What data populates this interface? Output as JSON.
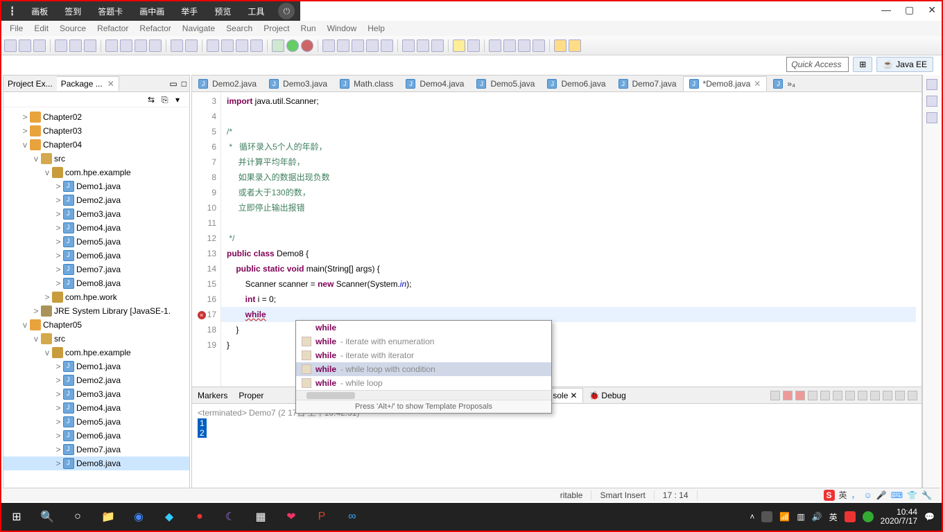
{
  "overlay": {
    "items": [
      "画板",
      "签到",
      "答题卡",
      "画中画",
      "举手",
      "预览",
      "工具"
    ]
  },
  "menus": [
    "File",
    "Edit",
    "Source",
    "Refactor",
    "Refactor",
    "Navigate",
    "Search",
    "Project",
    "Run",
    "Window",
    "Help"
  ],
  "quick_access": {
    "placeholder": "Quick Access",
    "perspective": "Java EE"
  },
  "side_tabs": {
    "project": "Project Ex...",
    "package": "Package ..."
  },
  "tree": [
    {
      "d": 1,
      "t": "tw",
      "l": ">",
      "ico": "proj",
      "txt": "Chapter02"
    },
    {
      "d": 1,
      "t": "tw",
      "l": ">",
      "ico": "proj",
      "txt": "Chapter03"
    },
    {
      "d": 1,
      "t": "tw",
      "l": "v",
      "ico": "proj",
      "txt": "Chapter04"
    },
    {
      "d": 2,
      "t": "tw",
      "l": "v",
      "ico": "src",
      "txt": "src"
    },
    {
      "d": 3,
      "t": "tw",
      "l": "v",
      "ico": "pkg",
      "txt": "com.hpe.example"
    },
    {
      "d": 4,
      "t": "tw",
      "l": ">",
      "ico": "java",
      "txt": "Demo1.java"
    },
    {
      "d": 4,
      "t": "tw",
      "l": ">",
      "ico": "java",
      "txt": "Demo2.java"
    },
    {
      "d": 4,
      "t": "tw",
      "l": ">",
      "ico": "java",
      "txt": "Demo3.java"
    },
    {
      "d": 4,
      "t": "tw",
      "l": ">",
      "ico": "java",
      "txt": "Demo4.java"
    },
    {
      "d": 4,
      "t": "tw",
      "l": ">",
      "ico": "java",
      "txt": "Demo5.java"
    },
    {
      "d": 4,
      "t": "tw",
      "l": ">",
      "ico": "java",
      "txt": "Demo6.java"
    },
    {
      "d": 4,
      "t": "tw",
      "l": ">",
      "ico": "java",
      "txt": "Demo7.java"
    },
    {
      "d": 4,
      "t": "tw",
      "l": ">",
      "ico": "java",
      "txt": "Demo8.java"
    },
    {
      "d": 3,
      "t": "tw",
      "l": ">",
      "ico": "pkg",
      "txt": "com.hpe.work"
    },
    {
      "d": 2,
      "t": "tw",
      "l": ">",
      "ico": "lib",
      "txt": "JRE System Library [JavaSE-1."
    },
    {
      "d": 1,
      "t": "tw",
      "l": "v",
      "ico": "proj",
      "txt": "Chapter05"
    },
    {
      "d": 2,
      "t": "tw",
      "l": "v",
      "ico": "src",
      "txt": "src"
    },
    {
      "d": 3,
      "t": "tw",
      "l": "v",
      "ico": "pkg",
      "txt": "com.hpe.example"
    },
    {
      "d": 4,
      "t": "tw",
      "l": ">",
      "ico": "java",
      "txt": "Demo1.java"
    },
    {
      "d": 4,
      "t": "tw",
      "l": ">",
      "ico": "java",
      "txt": "Demo2.java"
    },
    {
      "d": 4,
      "t": "tw",
      "l": ">",
      "ico": "java",
      "txt": "Demo3.java"
    },
    {
      "d": 4,
      "t": "tw",
      "l": ">",
      "ico": "java",
      "txt": "Demo4.java"
    },
    {
      "d": 4,
      "t": "tw",
      "l": ">",
      "ico": "java",
      "txt": "Demo5.java"
    },
    {
      "d": 4,
      "t": "tw",
      "l": ">",
      "ico": "java",
      "txt": "Demo6.java"
    },
    {
      "d": 4,
      "t": "tw",
      "l": ">",
      "ico": "java",
      "txt": "Demo7.java"
    },
    {
      "d": 4,
      "t": "tw",
      "l": ">",
      "ico": "java",
      "txt": "Demo8.java",
      "sel": true
    }
  ],
  "editor_tabs": [
    {
      "label": "Demo2.java"
    },
    {
      "label": "Demo3.java"
    },
    {
      "label": "Math.class"
    },
    {
      "label": "Demo4.java"
    },
    {
      "label": "Demo5.java"
    },
    {
      "label": "Demo6.java"
    },
    {
      "label": "Demo7.java"
    },
    {
      "label": "*Demo8.java",
      "active": true
    },
    {
      "label": "»₄"
    }
  ],
  "code_lines": [
    {
      "n": 3,
      "h": "<span class='kw'>import</span> java.util.Scanner;"
    },
    {
      "n": 4,
      "h": ""
    },
    {
      "n": 5,
      "h": "<span class='cmt'>/*</span>"
    },
    {
      "n": 6,
      "h": "<span class='cmt'> *   循环录入5个人的年龄，</span>"
    },
    {
      "n": 7,
      "h": "<span class='cmt'>     并计算平均年龄，</span>"
    },
    {
      "n": 8,
      "h": "<span class='cmt'>     如果录入的数据出现负数</span>"
    },
    {
      "n": 9,
      "h": "<span class='cmt'>     或者大于130的数，</span>"
    },
    {
      "n": 10,
      "h": "<span class='cmt'>     立即停止输出报错</span>"
    },
    {
      "n": 11,
      "h": ""
    },
    {
      "n": 12,
      "h": "<span class='cmt'> */</span>"
    },
    {
      "n": 13,
      "h": "<span class='kw'>public</span> <span class='kw'>class</span> Demo8 {"
    },
    {
      "n": 14,
      "h": "    <span class='kw'>public</span> <span class='kw'>static</span> <span class='kw'>void</span> main(String[] args) {"
    },
    {
      "n": 15,
      "h": "        Scanner scanner = <span class='kw'>new</span> Scanner(System.<span class='fld'>in</span>);"
    },
    {
      "n": 16,
      "h": "        <span class='kw'>int</span> i = 0;"
    },
    {
      "n": 17,
      "err": true,
      "hl": true,
      "h": "        <span class='kw err-u'>while</span>"
    },
    {
      "n": 18,
      "h": "    }"
    },
    {
      "n": 19,
      "h": "}"
    }
  ],
  "autocomplete": {
    "rows": [
      {
        "kw": "while",
        "hint": ""
      },
      {
        "kw": "while",
        "hint": " - iterate with enumeration",
        "icon": true
      },
      {
        "kw": "while",
        "hint": " - iterate with iterator",
        "icon": true
      },
      {
        "kw": "while",
        "hint": " - while loop with condition",
        "icon": true,
        "hl": true
      },
      {
        "kw": "while",
        "hint": " - while loop",
        "icon": true
      }
    ],
    "footer": "Press 'Alt+/' to show Template Proposals"
  },
  "bottom_tabs": [
    "Markers",
    "Proper",
    "sole",
    "Debug"
  ],
  "console": {
    "header": "<terminated> Demo7 (2                                                          17日 上午10:42:51)",
    "out": [
      "1",
      "2"
    ]
  },
  "status": {
    "writable": "ritable",
    "smart": "Smart Insert",
    "pos": "17 : 14"
  },
  "systray": {
    "ime": "英",
    "time": "10:44",
    "date": "2020/7/17"
  }
}
